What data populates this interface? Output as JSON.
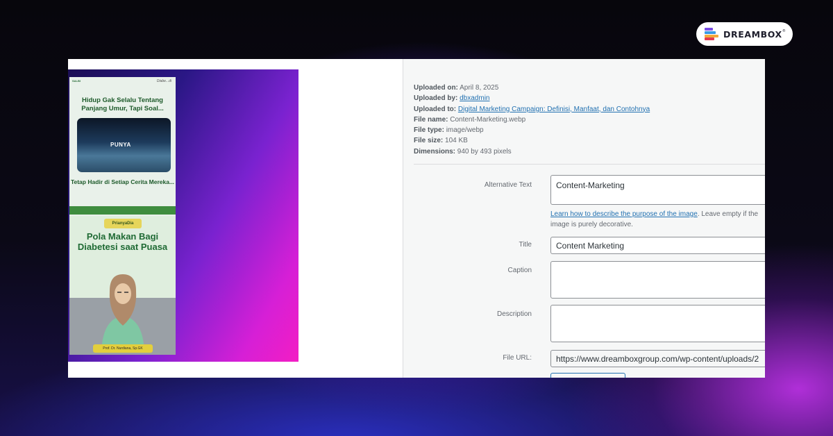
{
  "brand": {
    "name": "DREAMBOX",
    "mark": "®",
    "logo_colors": [
      "#e43b4f",
      "#f3a93a",
      "#3a9be4",
      "#7a4ce4"
    ]
  },
  "preview": {
    "top_left_mini": "SALBI",
    "top_right_mini": "Diabe...di",
    "headline_1": "Hidup Gak Selalu Tentang Panjang Umur, Tapi Soal...",
    "photo_label": "PUNYA",
    "headline_2": "Tetap Hadir di Setiap Cerita Mereka...",
    "badge": "PrianyaDia",
    "headline_3": "Pola Makan Bagi Diabetesi saat Puasa",
    "name_tag": "Prof. Dr. Nurdiana, Sp.GK"
  },
  "meta": {
    "uploaded_on_label": "Uploaded on:",
    "uploaded_on": "April 8, 2025",
    "uploaded_by_label": "Uploaded by:",
    "uploaded_by": "dbxadmin",
    "uploaded_to_label": "Uploaded to:",
    "uploaded_to": "Digital Marketing Campaign: Definisi, Manfaat, dan Contohnya",
    "file_name_label": "File name:",
    "file_name": "Content-Marketing.webp",
    "file_type_label": "File type:",
    "file_type": "image/webp",
    "file_size_label": "File size:",
    "file_size": "104 KB",
    "dimensions_label": "Dimensions:",
    "dimensions": "940 by 493 pixels"
  },
  "form": {
    "alt_label": "Alternative Text",
    "alt_value": "Content-Marketing",
    "help_link": "Learn how to describe the purpose of the image",
    "help_text": ". Leave empty if the image is purely decorative.",
    "title_label": "Title",
    "title_value": "Content Marketing",
    "caption_label": "Caption",
    "caption_value": "",
    "description_label": "Description",
    "description_value": "",
    "file_url_label": "File URL:",
    "file_url_value": "https://www.dreamboxgroup.com/wp-content/uploads/2"
  }
}
